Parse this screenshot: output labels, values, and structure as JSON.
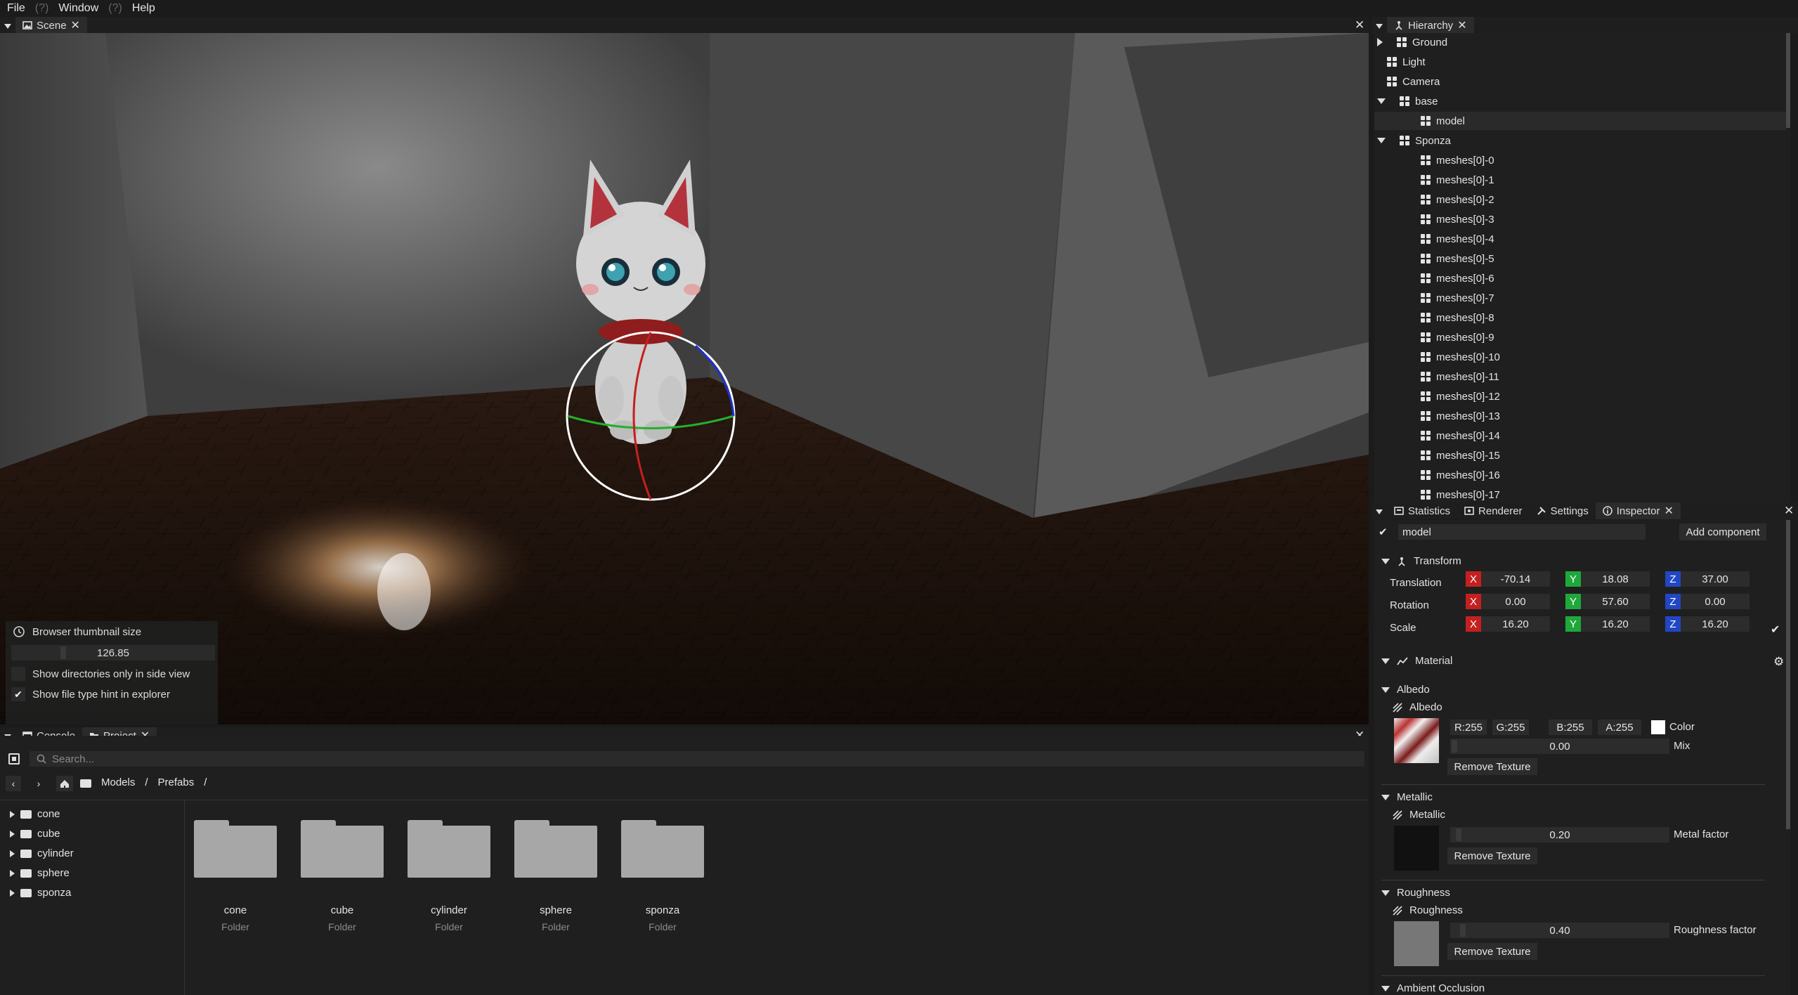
{
  "menu": {
    "file": "File",
    "q1": "(?)",
    "window": "Window",
    "q2": "(?)",
    "help": "Help"
  },
  "scene_tab": {
    "label": "Scene"
  },
  "hierarchy": {
    "title": "Hierarchy",
    "items": [
      "Ground",
      "Light",
      "Camera",
      "base",
      "model",
      "Sponza",
      "meshes[0]-0",
      "meshes[0]-1",
      "meshes[0]-2",
      "meshes[0]-3",
      "meshes[0]-4",
      "meshes[0]-5",
      "meshes[0]-6",
      "meshes[0]-7",
      "meshes[0]-8",
      "meshes[0]-9",
      "meshes[0]-10",
      "meshes[0]-11",
      "meshes[0]-12",
      "meshes[0]-13",
      "meshes[0]-14",
      "meshes[0]-15",
      "meshes[0]-16",
      "meshes[0]-17"
    ]
  },
  "inspector_tabs": {
    "statistics": "Statistics",
    "renderer": "Renderer",
    "settings": "Settings",
    "inspector": "Inspector"
  },
  "inspector": {
    "object_name": "model",
    "add_component": "Add component",
    "transform": {
      "title": "Transform",
      "translation_label": "Translation",
      "rotation_label": "Rotation",
      "scale_label": "Scale",
      "translation": [
        "-70.14",
        "18.08",
        "37.00"
      ],
      "rotation": [
        "0.00",
        "57.60",
        "0.00"
      ],
      "scale": [
        "16.20",
        "16.20",
        "16.20"
      ],
      "x": "X",
      "y": "Y",
      "z": "Z"
    },
    "material": {
      "title": "Material",
      "albedo": {
        "section": "Albedo",
        "label": "Albedo",
        "r": "R:255",
        "g": "G:255",
        "b": "B:255",
        "a": "A:255",
        "color_label": "Color",
        "mix_value": "0.00",
        "mix_label": "Mix",
        "remove": "Remove Texture"
      },
      "metallic": {
        "section": "Metallic",
        "label": "Metallic",
        "value": "0.20",
        "factor_label": "Metal factor",
        "remove": "Remove Texture"
      },
      "roughness": {
        "section": "Roughness",
        "label": "Roughness",
        "value": "0.40",
        "factor_label": "Roughness factor",
        "remove": "Remove Texture"
      },
      "ao": {
        "section": "Ambient Occlusion"
      }
    }
  },
  "overlay": {
    "thumb_title": "Browser thumbnail size",
    "thumb_value": "126.85",
    "dirs_only": "Show directories only in side view",
    "file_hint": "Show file type hint in explorer"
  },
  "bottom_tabs": {
    "console": "Console",
    "project": "Project"
  },
  "project": {
    "search_placeholder": "Search...",
    "crumbs": [
      "Models",
      "/",
      "Prefabs",
      "/"
    ],
    "tree": [
      "cone",
      "cube",
      "cylinder",
      "sphere",
      "sponza"
    ],
    "folders": [
      {
        "name": "cone",
        "type": "Folder"
      },
      {
        "name": "cube",
        "type": "Folder"
      },
      {
        "name": "cylinder",
        "type": "Folder"
      },
      {
        "name": "sphere",
        "type": "Folder"
      },
      {
        "name": "sponza",
        "type": "Folder"
      }
    ]
  },
  "colors": {
    "axis_x": "#c42020",
    "axis_y": "#1fa83a",
    "axis_z": "#2147c4",
    "panel": "#1f1f1f",
    "field": "#2c2c2c"
  }
}
